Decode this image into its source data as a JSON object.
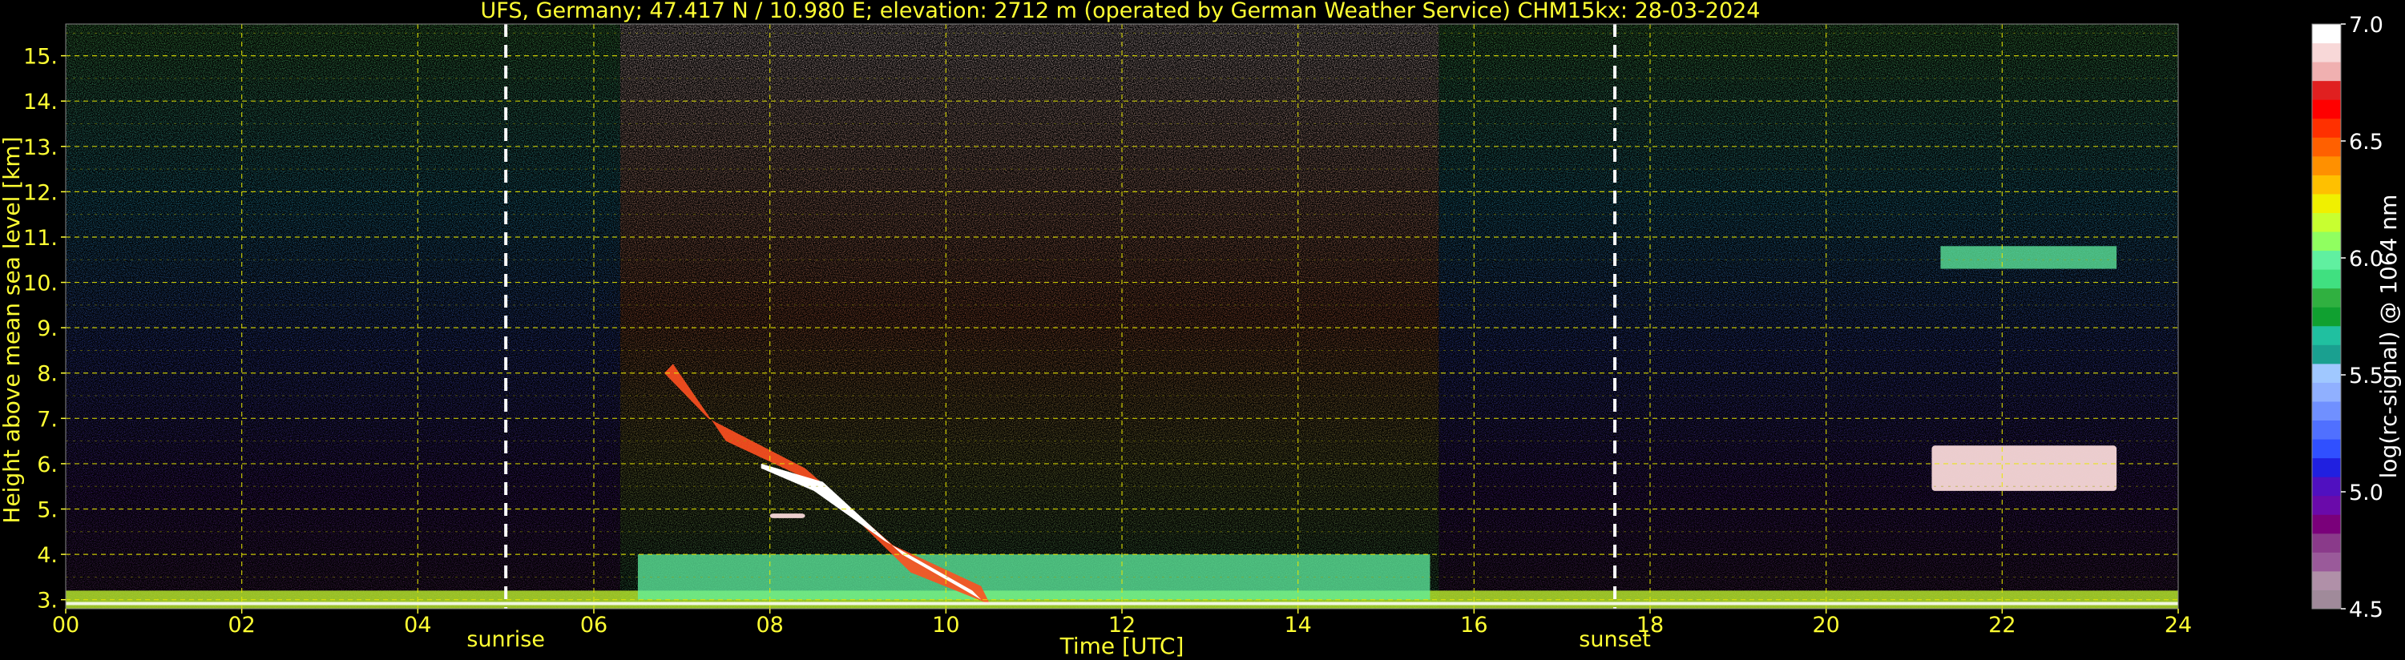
{
  "chart_data": {
    "type": "heatmap",
    "title": "UFS, Germany; 47.417 N / 10.980 E; elevation: 2712 m  (operated by German Weather Service)    CHM15kx: 28-03-2024",
    "xlabel": "Time [UTC]",
    "ylabel": "Height above mean sea level [km]",
    "xlim": [
      0,
      24
    ],
    "ylim": [
      2.8,
      15.7
    ],
    "x_ticks": [
      "00",
      "02",
      "04",
      "06",
      "08",
      "10",
      "12",
      "14",
      "16",
      "18",
      "20",
      "22",
      "24"
    ],
    "y_ticks": [
      "3.",
      "4.",
      "5.",
      "6.",
      "7.",
      "8.",
      "9.",
      "10.",
      "11.",
      "12.",
      "13.",
      "14.",
      "15."
    ],
    "grid": true,
    "markers": [
      {
        "label": "sunrise",
        "x": 5.0
      },
      {
        "label": "sunset",
        "x": 17.6
      }
    ],
    "colorbar": {
      "label": "log(rc-signal) @ 1064 nm",
      "range": [
        4.5,
        7.0
      ],
      "ticks": [
        "4.5",
        "5.0",
        "5.5",
        "6.0",
        "6.5",
        "7.0"
      ],
      "colors": [
        "#a08a9a",
        "#b090a8",
        "#9a5a9a",
        "#8a3a8a",
        "#7a007a",
        "#6a0aaa",
        "#5010c0",
        "#2020e0",
        "#3050ff",
        "#5070ff",
        "#7090ff",
        "#90b0ff",
        "#a0c8ff",
        "#1aa090",
        "#20c0a0",
        "#10a030",
        "#30b040",
        "#40e080",
        "#60f0a0",
        "#90ff60",
        "#c8ff30",
        "#f0f000",
        "#ffc000",
        "#ff9000",
        "#ff6000",
        "#ff3000",
        "#ff0000",
        "#e02020",
        "#f0b0b0",
        "#f8d8d8",
        "#ffffff"
      ]
    },
    "features": [
      {
        "name": "boundary layer aerosol",
        "x": [
          0,
          24
        ],
        "y": [
          2.8,
          3.2
        ],
        "value": 6.2
      },
      {
        "name": "daytime residual layer",
        "x": [
          6.5,
          15.5
        ],
        "y": [
          3.0,
          4.0
        ],
        "value": 6.0
      },
      {
        "name": "descending cloud layer",
        "x": [
          6.9,
          10.5
        ],
        "y": [
          2.9,
          8.2
        ],
        "value": 6.8
      },
      {
        "name": "small cloud",
        "x": [
          8.0,
          8.4
        ],
        "y": [
          4.8,
          4.9
        ],
        "value": 6.9
      },
      {
        "name": "cloud near 6 km",
        "x": [
          21.2,
          23.3
        ],
        "y": [
          5.4,
          6.4
        ],
        "value": 6.9
      },
      {
        "name": "thin cirrus near 10.5 km",
        "x": [
          21.3,
          23.3
        ],
        "y": [
          10.3,
          10.8
        ],
        "value": 6.0
      },
      {
        "name": "background noise daytime",
        "x": [
          6.0,
          15.5
        ],
        "y": [
          8.0,
          15.7
        ],
        "value": 6.6
      },
      {
        "name": "background noise nighttime",
        "x": [
          0,
          6.0
        ],
        "y": [
          3.2,
          15.7
        ],
        "value": 5.4
      },
      {
        "name": "background noise evening",
        "x": [
          17.6,
          24
        ],
        "y": [
          3.2,
          15.7
        ],
        "value": 5.4
      }
    ]
  }
}
